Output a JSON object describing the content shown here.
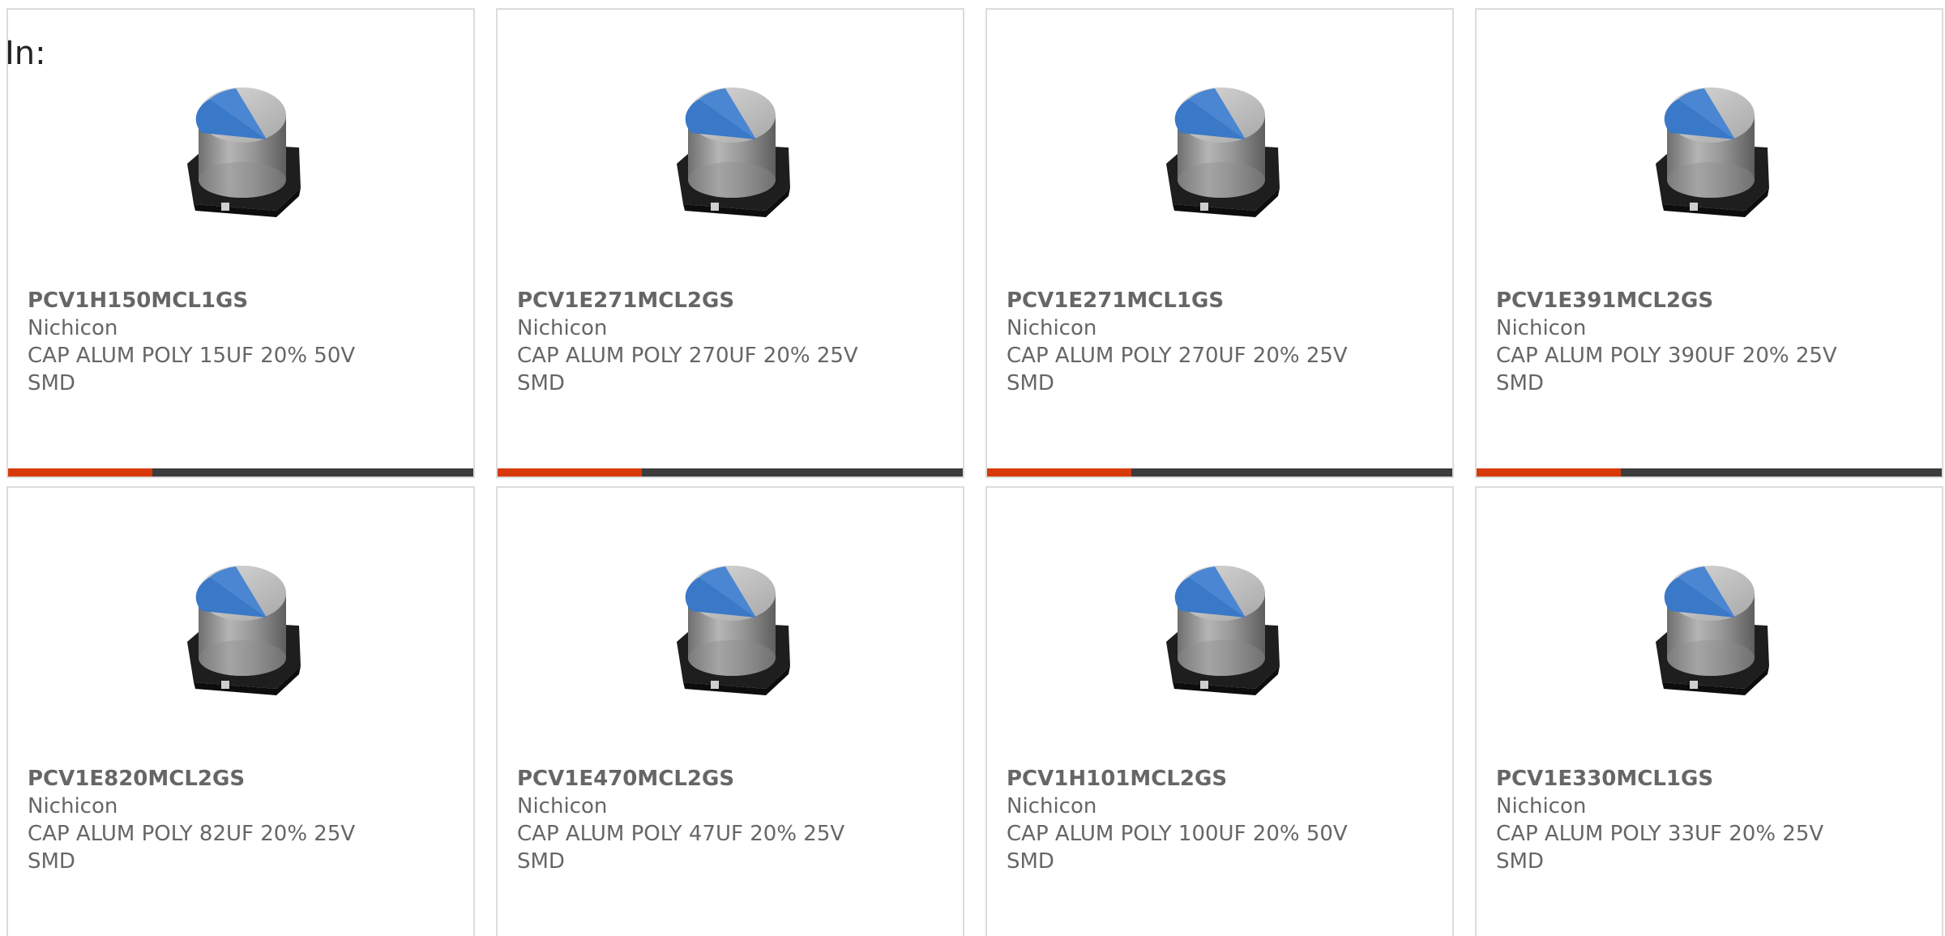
{
  "label": "In:",
  "colors": {
    "card_border": "#dcdcdc",
    "bar_dark": "#3c3c3c",
    "bar_accent": "#d8390a",
    "text": "#666666"
  },
  "products": [
    {
      "part_number": "PCV1H150MCL1GS",
      "manufacturer": "Nichicon",
      "description": "CAP ALUM POLY 15UF 20% 50V",
      "package": "SMD",
      "image_icon": "capacitor-icon",
      "bar_progress": 0.31
    },
    {
      "part_number": "PCV1E271MCL2GS",
      "manufacturer": "Nichicon",
      "description": "CAP ALUM POLY 270UF 20% 25V",
      "package": "SMD",
      "image_icon": "capacitor-icon",
      "bar_progress": 0.31
    },
    {
      "part_number": "PCV1E271MCL1GS",
      "manufacturer": "Nichicon",
      "description": "CAP ALUM POLY 270UF 20% 25V",
      "package": "SMD",
      "image_icon": "capacitor-icon",
      "bar_progress": 0.31
    },
    {
      "part_number": "PCV1E391MCL2GS",
      "manufacturer": "Nichicon",
      "description": "CAP ALUM POLY 390UF 20% 25V",
      "package": "SMD",
      "image_icon": "capacitor-icon",
      "bar_progress": 0.31
    },
    {
      "part_number": "PCV1E820MCL2GS",
      "manufacturer": "Nichicon",
      "description": "CAP ALUM POLY 82UF 20% 25V",
      "package": "SMD",
      "image_icon": "capacitor-icon",
      "bar_progress": null
    },
    {
      "part_number": "PCV1E470MCL2GS",
      "manufacturer": "Nichicon",
      "description": "CAP ALUM POLY 47UF 20% 25V",
      "package": "SMD",
      "image_icon": "capacitor-icon",
      "bar_progress": null
    },
    {
      "part_number": "PCV1H101MCL2GS",
      "manufacturer": "Nichicon",
      "description": "CAP ALUM POLY 100UF 20% 50V",
      "package": "SMD",
      "image_icon": "capacitor-icon",
      "bar_progress": null
    },
    {
      "part_number": "PCV1E330MCL1GS",
      "manufacturer": "Nichicon",
      "description": "CAP ALUM POLY 33UF 20% 25V",
      "package": "SMD",
      "image_icon": "capacitor-icon",
      "bar_progress": null
    }
  ]
}
